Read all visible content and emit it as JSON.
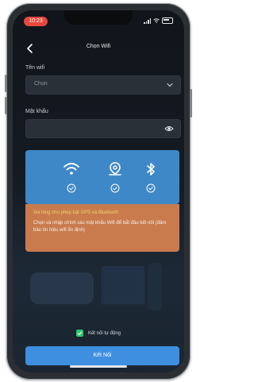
{
  "status": {
    "time": "10:23"
  },
  "header": {
    "title": "Chọn Wifi"
  },
  "wifi_name": {
    "label": "Tên wifi",
    "placeholder": "Chọn"
  },
  "password": {
    "label": "Mật khẩu",
    "value": ""
  },
  "permissions": {
    "icons": [
      "wifi-icon",
      "location-icon",
      "bluetooth-icon"
    ],
    "checked": [
      true,
      true,
      true
    ]
  },
  "tip": {
    "heading": "Vui lòng cho phép bật GPS và Bluetooth",
    "body": "Chọn và nhập chính xác mật khẩu Wifi để bắt đầu kết nối (đảm bảo tín hiệu wifi ổn định)"
  },
  "auto_connect": {
    "label": "Kết nối tự động",
    "checked": true
  },
  "connect_button": {
    "label": "Kết Nối"
  },
  "colors": {
    "accent": "#3e8fe0",
    "card": "#3f88c7",
    "tip_bg": "#c97b4e",
    "tip_heading": "#f2d36a",
    "check": "#29c86a"
  }
}
